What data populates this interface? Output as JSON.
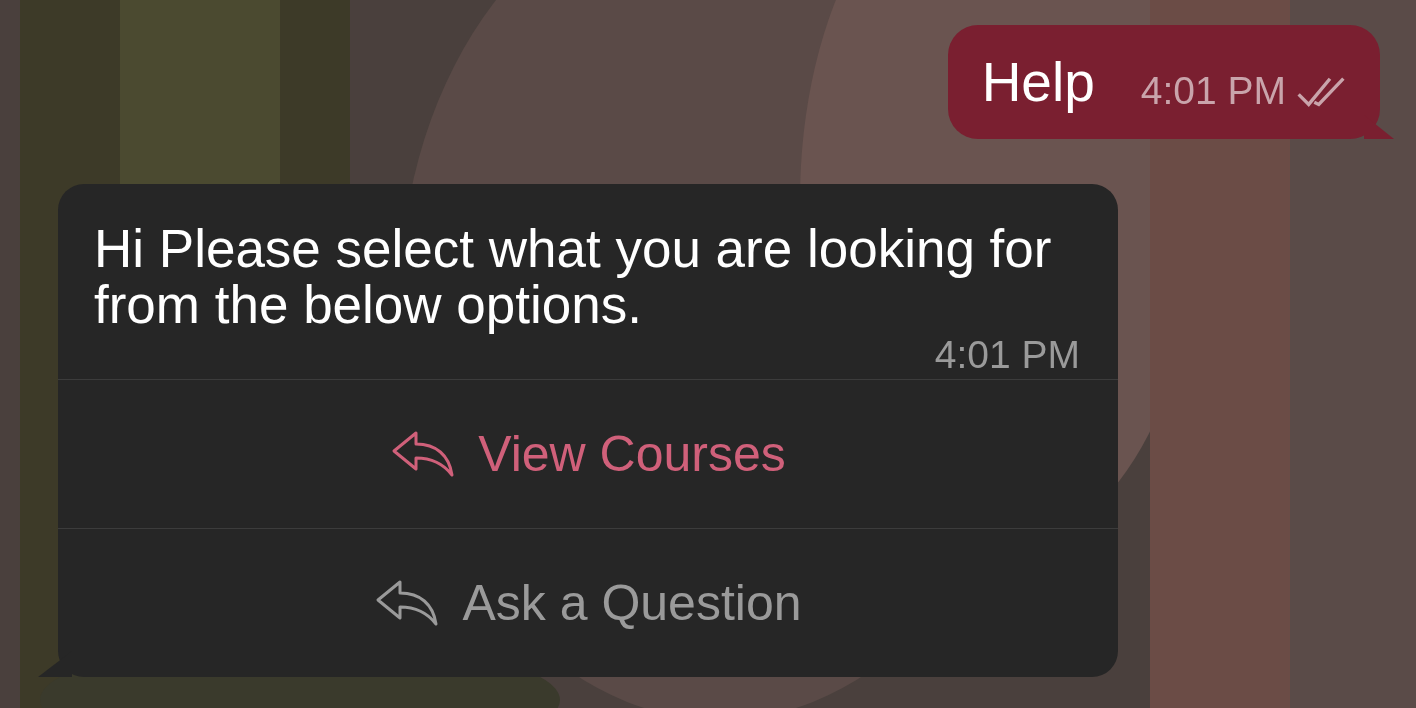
{
  "sent_message": {
    "text": "Help",
    "time": "4:01 PM",
    "read": true
  },
  "received_message": {
    "text": "Hi Please select what you are looking for from the below options.",
    "time": "4:01 PM"
  },
  "reply_options": [
    {
      "label": "View Courses",
      "selected": true
    },
    {
      "label": "Ask a Question",
      "selected": false
    }
  ]
}
